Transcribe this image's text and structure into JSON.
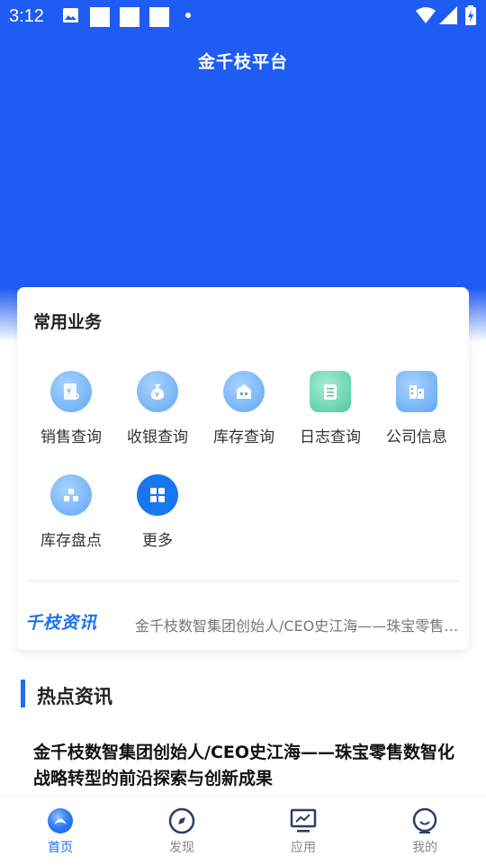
{
  "status_bar": {
    "time": "3:12"
  },
  "header": {
    "title": "金千枝平台"
  },
  "services": {
    "title": "常用业务",
    "items": [
      {
        "label": "销售查询",
        "icon": "sales-receipt-icon"
      },
      {
        "label": "收银查询",
        "icon": "money-bag-icon"
      },
      {
        "label": "库存查询",
        "icon": "warehouse-icon"
      },
      {
        "label": "日志查询",
        "icon": "notebook-icon"
      },
      {
        "label": "公司信息",
        "icon": "building-icon"
      },
      {
        "label": "库存盘点",
        "icon": "boxes-icon"
      },
      {
        "label": "更多",
        "icon": "grid-icon"
      }
    ]
  },
  "news_ticker": {
    "logo": "千枝资讯",
    "text": "金千枝数智集团创始人/CEO史江海——珠宝零售数智化战略转型的前沿探索与创新成果"
  },
  "hot_news": {
    "title": "热点资讯",
    "articles": [
      {
        "title": "金千枝数智集团创始人/CEO史江海——珠宝零售数智化战略转型的前沿探索与创新成果"
      }
    ]
  },
  "bottom_nav": {
    "items": [
      {
        "label": "首页",
        "icon": "home-icon",
        "active": true
      },
      {
        "label": "发现",
        "icon": "compass-icon",
        "active": false
      },
      {
        "label": "应用",
        "icon": "monitor-icon",
        "active": false
      },
      {
        "label": "我的",
        "icon": "profile-icon",
        "active": false
      }
    ]
  },
  "colors": {
    "primary": "#1e5cf3",
    "accent": "#1e6ef0"
  }
}
